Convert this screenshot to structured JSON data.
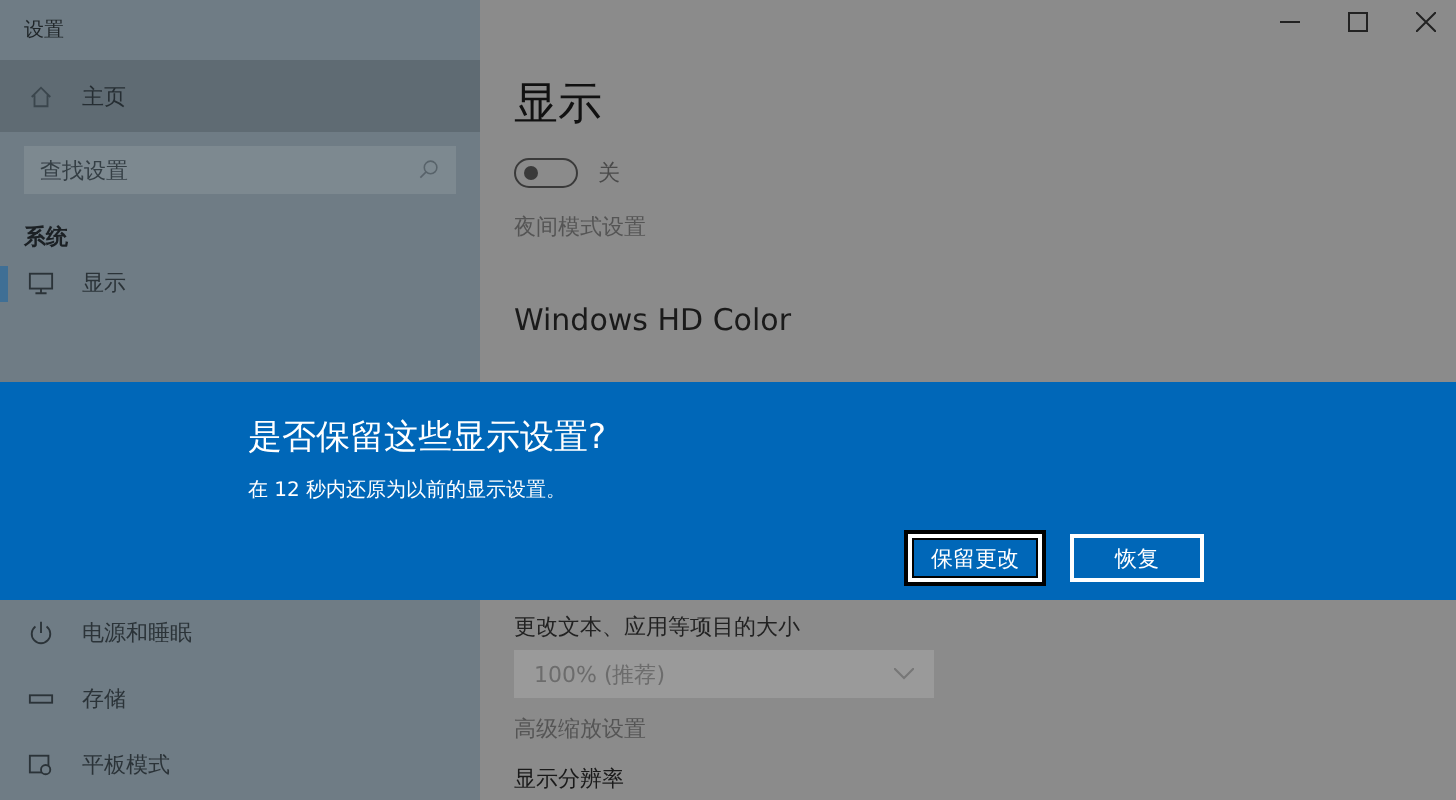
{
  "window": {
    "title": "设置"
  },
  "sidebar": {
    "home": {
      "label": "主页",
      "selected": true
    },
    "search": {
      "placeholder": "查找设置"
    },
    "section": "系统",
    "items_top": [
      {
        "label": "显示",
        "selected": true
      }
    ],
    "items_bottom": [
      {
        "label": "电源和睡眠"
      },
      {
        "label": "存储"
      },
      {
        "label": "平板模式"
      }
    ]
  },
  "content": {
    "heading": "显示",
    "night_light": {
      "on": false,
      "state_label": "关"
    },
    "night_link": "夜间模式设置",
    "hd_heading": "Windows HD Color",
    "scale_label": "更改文本、应用等项目的大小",
    "scale_value": "100% (推荐)",
    "scale_link": "高级缩放设置",
    "resolution_label": "显示分辨率"
  },
  "dialog": {
    "title": "是否保留这些显示设置?",
    "message": "在 12 秒内还原为以前的显示设置。",
    "buttons": [
      {
        "label": "保留更改",
        "selected": true
      },
      {
        "label": "恢复",
        "selected": false
      }
    ]
  }
}
